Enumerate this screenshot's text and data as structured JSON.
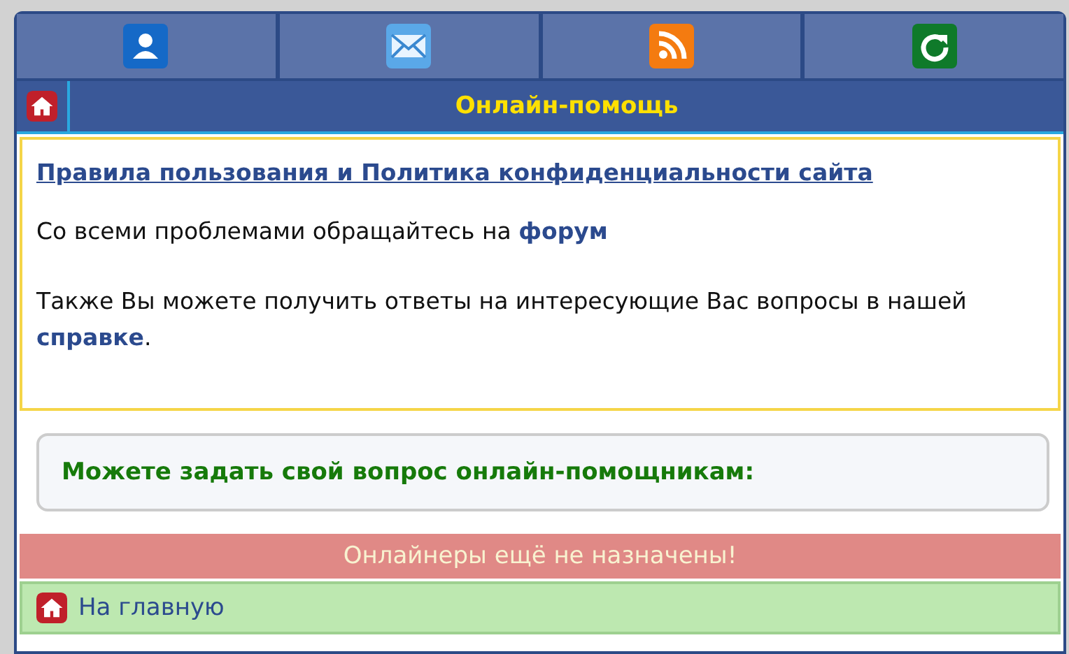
{
  "nav_buttons": [
    {
      "kind": "profile"
    },
    {
      "kind": "mail"
    },
    {
      "kind": "rss"
    },
    {
      "kind": "refresh"
    }
  ],
  "header": {
    "title": "Онлайн-помощь"
  },
  "info": {
    "rules_link": "Правила пользования и Политика конфиденциальности сайта",
    "paragraphs": [
      {
        "text": "Со всеми проблемами обращайтесь на",
        "link": "форум"
      },
      {
        "text": "Также Вы можете получить ответы на интересующие Вас вопросы в нашей",
        "link": "справке",
        "after": "."
      }
    ]
  },
  "question_prompt": "Можете задать свой вопрос онлайн-помощникам:",
  "status_notice": "Онлайнеры ещё не назначены!",
  "home_link": "На главную"
}
